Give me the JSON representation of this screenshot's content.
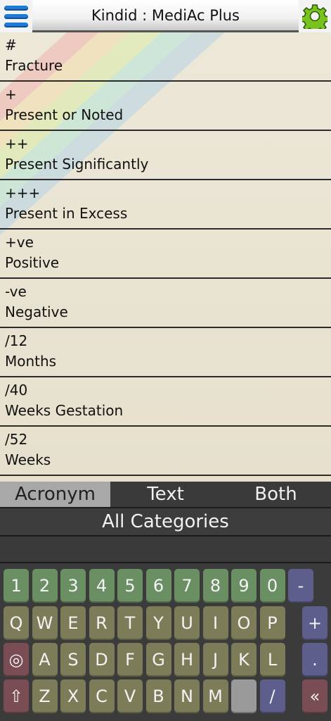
{
  "header": {
    "title": "Kindid : MediAc Plus"
  },
  "items": [
    {
      "acronym": "#",
      "text": "Fracture"
    },
    {
      "acronym": "+",
      "text": "Present or Noted"
    },
    {
      "acronym": "++",
      "text": "Present Significantly"
    },
    {
      "acronym": "+++",
      "text": "Present in Excess"
    },
    {
      "acronym": "+ve",
      "text": "Positive"
    },
    {
      "acronym": "-ve",
      "text": "Negative"
    },
    {
      "acronym": "/12",
      "text": "Months"
    },
    {
      "acronym": "/40",
      "text": "Weeks Gestation"
    },
    {
      "acronym": "/52",
      "text": "Weeks"
    }
  ],
  "tabs": [
    "Acronym",
    "Text",
    "Both"
  ],
  "category": "All Categories",
  "keyboard": {
    "row1": [
      "1",
      "2",
      "3",
      "4",
      "5",
      "6",
      "7",
      "8",
      "9",
      "0",
      "-"
    ],
    "row2": [
      "Q",
      "W",
      "E",
      "R",
      "T",
      "Y",
      "U",
      "I",
      "O",
      "P",
      "+"
    ],
    "row3": [
      "◎",
      "A",
      "S",
      "D",
      "F",
      "G",
      "H",
      "J",
      "K",
      "L",
      "."
    ],
    "row4": [
      "⇧",
      "Z",
      "X",
      "C",
      "V",
      "B",
      "N",
      "M",
      "",
      "/",
      "«"
    ]
  },
  "colors": {
    "number_key": "#6a8f63",
    "letter_key": "#7c7d58",
    "operator_key": "#5d5e8c",
    "menu_icon": "#1e7bd6",
    "gear_icon": "#7ac21e"
  },
  "icons": {
    "menu": "hamburger-menu-icon",
    "settings": "gear-icon"
  }
}
